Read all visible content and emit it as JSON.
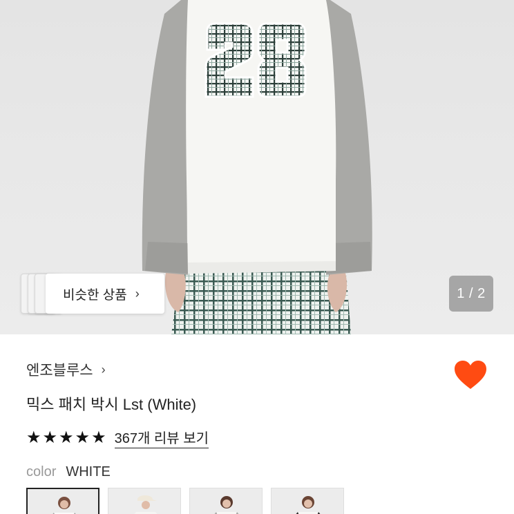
{
  "gallery": {
    "similar_label": "비슷한 상품",
    "similar_chevron": "›",
    "counter": "1 / 2",
    "print_number": "28"
  },
  "product": {
    "brand": "엔조블루스",
    "brand_chevron": "›",
    "title": "믹스 패치 박시 Lst (White)",
    "rating_stars": 5,
    "review_link": "367개 리뷰 보기",
    "color_label": "color",
    "color_value": "WHITE"
  },
  "colors": {
    "heart": "#ff4b12",
    "stars": "#111111"
  },
  "swatches": [
    {
      "name": "white",
      "selected": true
    },
    {
      "name": "cap",
      "selected": false
    },
    {
      "name": "model-3",
      "selected": false
    },
    {
      "name": "model-4",
      "selected": false
    }
  ]
}
